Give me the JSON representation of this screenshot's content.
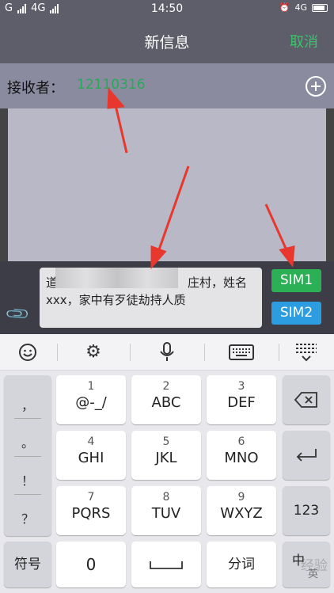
{
  "status_bar": {
    "carrier1": "G",
    "carrier2": "4G",
    "time": "14:50",
    "network": "4G",
    "icons": [
      "signal-icon",
      "alarm-icon",
      "battery-icon"
    ]
  },
  "header": {
    "title": "新信息",
    "cancel_label": "取消"
  },
  "recipient": {
    "label": "接收者：",
    "number": "12110316"
  },
  "compose": {
    "message_line1": "道",
    "message_line1_tail": "庄村，姓名",
    "message_line2": "xxx，家中有歹徒劫持人质",
    "sim1_label": "SIM1",
    "sim2_label": "SIM2"
  },
  "keyboard_toolbar": {
    "icons": [
      "emoji-icon",
      "settings-gear-icon",
      "microphone-icon",
      "keyboard-icon",
      "keyboard-hide-icon"
    ]
  },
  "keyboard": {
    "punctuation": [
      "，",
      "。",
      "！",
      "？"
    ],
    "keys": [
      {
        "num": "1",
        "letters": "@-_/"
      },
      {
        "num": "2",
        "letters": "ABC"
      },
      {
        "num": "3",
        "letters": "DEF"
      },
      {
        "num": "4",
        "letters": "GHI"
      },
      {
        "num": "5",
        "letters": "JKL"
      },
      {
        "num": "6",
        "letters": "MNO"
      },
      {
        "num": "7",
        "letters": "PQRS"
      },
      {
        "num": "8",
        "letters": "TUV"
      },
      {
        "num": "9",
        "letters": "WXYZ"
      }
    ],
    "symbols_label": "符号",
    "zero_label": "0",
    "segment_label": "分词",
    "num_mode_label": "123",
    "lang_label": "中",
    "lang_sub_label": "英"
  },
  "watermark": "经验",
  "colors": {
    "accent_green": "#2cb055",
    "sim2_blue": "#2b9de0",
    "arrow_red": "#e8382e"
  }
}
